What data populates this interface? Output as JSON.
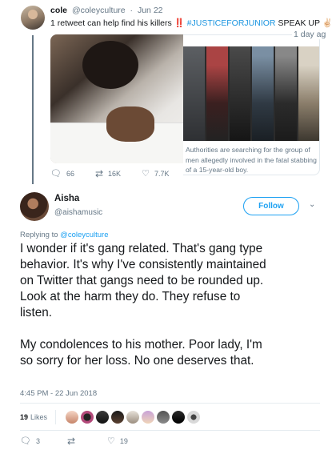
{
  "parent_tweet": {
    "name": "cole",
    "handle": "@coleyculture",
    "date": "Jun 22",
    "text_before": "1 retweet can help find his killers",
    "bangs": "‼️",
    "hashtag": "#JUSTICEFORJUNIOR",
    "text_after": "SPEAK UP",
    "clap_emoji": "✌🏻",
    "news_date": "1 day ag",
    "news_caption": "Authorities are searching for the group of men allegedly involved in the fatal stabbing of a 15-year-old boy.",
    "replies": "66",
    "retweets": "16K",
    "likes": "7.7K"
  },
  "tweet": {
    "name": "Aisha",
    "handle": "@aishamusic",
    "follow_label": "Follow",
    "replying_prefix": "Replying to",
    "replying_handle": "@coleyculture",
    "body_lines": [
      "I wonder if it's gang related. That's gang type",
      "behavior. It's why I've consistently maintained",
      "on Twitter that gangs need to be rounded up.",
      "Look at the harm they do. They refuse to",
      "listen."
    ],
    "body_lines_2": [
      "My condolences to his mother. Poor lady, I'm",
      "so sorry for her loss. No one deserves that."
    ],
    "timestamp": "4:45 PM - 22 Jun 2018",
    "likes_count": "19",
    "likes_label": "Likes",
    "replies": "3",
    "retweets": "",
    "likes": "19"
  },
  "icons": {
    "reply": "reply-icon",
    "retweet": "retweet-icon",
    "like": "heart-icon",
    "caret": "chevron-down-icon"
  },
  "colors": {
    "accent": "#1da1f2",
    "hashtag": "#1b95e0",
    "muted": "#657786",
    "text": "#14171a"
  }
}
